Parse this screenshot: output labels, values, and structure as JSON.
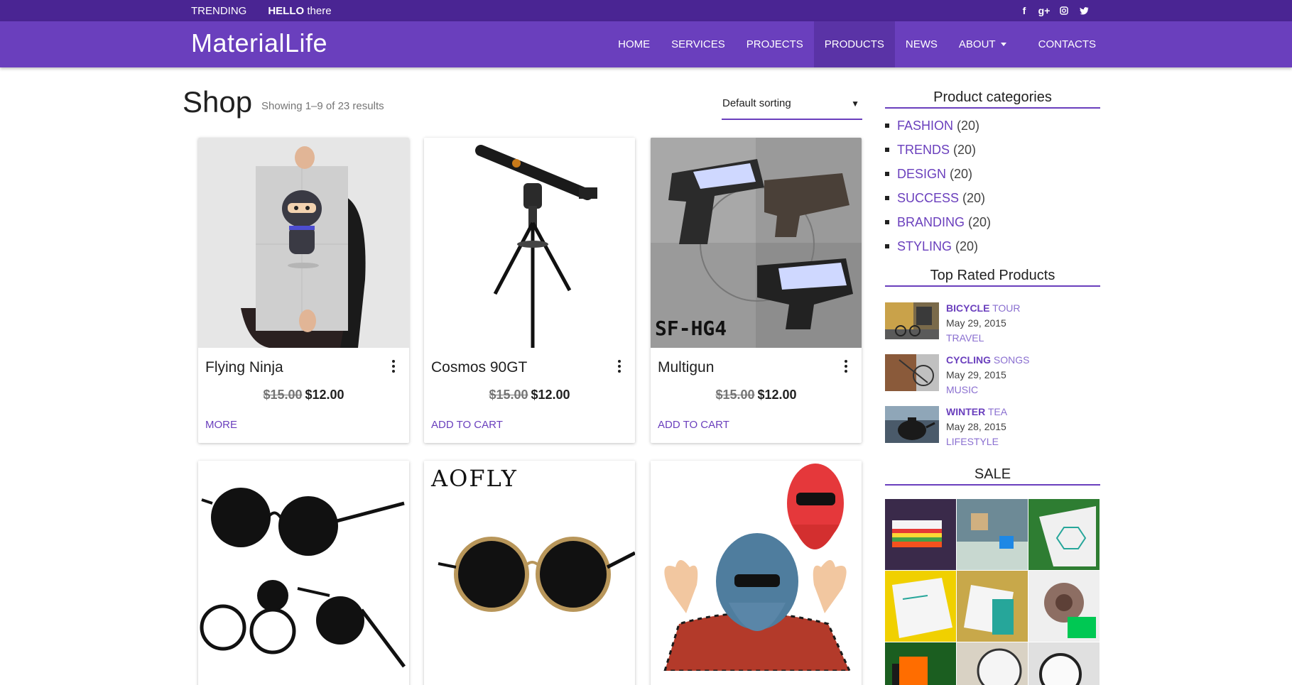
{
  "topbar": {
    "trending": "TRENDING",
    "hello_bold": "HELLO",
    "hello_rest": " there",
    "social": [
      "facebook-icon",
      "google-plus-icon",
      "instagram-icon",
      "twitter-icon"
    ]
  },
  "header": {
    "brand": "MaterialLife",
    "nav": [
      {
        "label": "HOME",
        "active": false
      },
      {
        "label": "SERVICES",
        "active": false
      },
      {
        "label": "PROJECTS",
        "active": false
      },
      {
        "label": "PRODUCTS",
        "active": true
      },
      {
        "label": "NEWS",
        "active": false
      },
      {
        "label": "ABOUT",
        "active": false,
        "dropdown": true
      },
      {
        "label": "CONTACTS",
        "active": false
      }
    ]
  },
  "shop": {
    "title": "Shop",
    "result_count": "Showing 1–9 of 23 results",
    "sorting": "Default sorting"
  },
  "products": [
    {
      "name": "Flying Ninja",
      "old_price": "$15.00",
      "price": "$12.00",
      "action": "MORE"
    },
    {
      "name": "Cosmos 90GT",
      "old_price": "$15.00",
      "price": "$12.00",
      "action": "ADD TO CART"
    },
    {
      "name": "Multigun",
      "old_price": "$15.00",
      "price": "$12.00",
      "action": "ADD TO CART",
      "image_text": "SF-HG4"
    },
    {
      "name": "",
      "old_price": "",
      "price": "",
      "action": ""
    },
    {
      "name": "",
      "old_price": "",
      "price": "",
      "action": "",
      "image_text": "AOFLY"
    },
    {
      "name": "",
      "old_price": "",
      "price": "",
      "action": ""
    }
  ],
  "sidebar": {
    "categories_title": "Product categories",
    "categories": [
      {
        "name": "FASHION",
        "count": "(20)"
      },
      {
        "name": "TRENDS",
        "count": "(20)"
      },
      {
        "name": "DESIGN",
        "count": "(20)"
      },
      {
        "name": "SUCCESS",
        "count": "(20)"
      },
      {
        "name": "BRANDING",
        "count": "(20)"
      },
      {
        "name": "STYLING",
        "count": "(20)"
      }
    ],
    "top_rated_title": "Top Rated Products",
    "top_rated": [
      {
        "bold": "BICYCLE",
        "rest": " TOUR",
        "date": "May 29, 2015",
        "tag": "TRAVEL"
      },
      {
        "bold": "CYCLING",
        "rest": " SONGS",
        "date": "May 29, 2015",
        "tag": "MUSIC"
      },
      {
        "bold": "WINTER",
        "rest": " TEA",
        "date": "May 28, 2015",
        "tag": "LIFESTYLE"
      }
    ],
    "sale_title": "SALE"
  },
  "colors": {
    "topbar": "#4a2593",
    "header": "#6a3fbd",
    "accent": "#6a3fbd"
  }
}
